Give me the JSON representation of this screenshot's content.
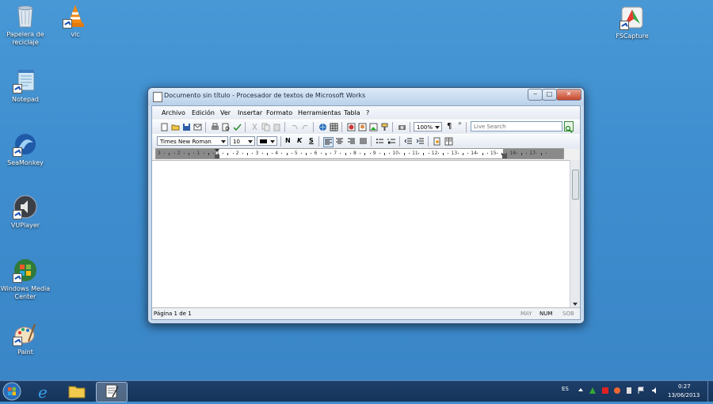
{
  "desktop": {
    "icons": [
      {
        "label_line1": "Papelera de",
        "label_line2": "reciclaje",
        "icon": "recycle-bin-icon"
      },
      {
        "label_line1": "vlc",
        "label_line2": "",
        "icon": "vlc-cone-icon"
      },
      {
        "label_line1": "Notepad",
        "label_line2": "",
        "icon": "notepad-icon"
      },
      {
        "label_line1": "SeaMonkey",
        "label_line2": "",
        "icon": "seamonkey-icon"
      },
      {
        "label_line1": "VUPlayer",
        "label_line2": "",
        "icon": "speaker-icon"
      },
      {
        "label_line1": "Windows Media",
        "label_line2": "Center",
        "icon": "windows-logo-icon"
      },
      {
        "label_line1": "Paint",
        "label_line2": "",
        "icon": "paint-palette-icon"
      },
      {
        "label_line1": "FSCapture",
        "label_line2": "",
        "icon": "fscapture-icon"
      }
    ]
  },
  "window": {
    "title": "Documento sin título - Procesador de textos de Microsoft Works",
    "controls": {
      "minimize": "‒",
      "maximize": "□",
      "close": "✕"
    },
    "menu": [
      "Archivo",
      "Edición",
      "Ver",
      "Insertar",
      "Formato",
      "Herramientas",
      "Tabla",
      "?"
    ],
    "toolbar": {
      "zoom": "100%",
      "paragraph_mark": "¶",
      "overflow": "»",
      "search_placeholder": "Live Search"
    },
    "format_bar": {
      "font": "Times New Roman",
      "size": "10",
      "bold": "N",
      "italic": "K",
      "strike": "S"
    },
    "ruler_numbers": [
      "3",
      "2",
      "1",
      "1",
      "2",
      "3",
      "4",
      "5",
      "6",
      "7",
      "8",
      "9",
      "10",
      "11",
      "12",
      "13",
      "14",
      "15",
      "16",
      "17"
    ],
    "status": {
      "page": "Página 1 de 1",
      "may": "MAY",
      "num": "NUM",
      "sob": "SOB"
    }
  },
  "taskbar": {
    "language": "ES",
    "time": "0:27",
    "date": "13/06/2013"
  },
  "colors": {
    "desktop": "#3f8ecf",
    "taskbar": "#1d3f6a",
    "window_frame": "#c9dcef"
  }
}
